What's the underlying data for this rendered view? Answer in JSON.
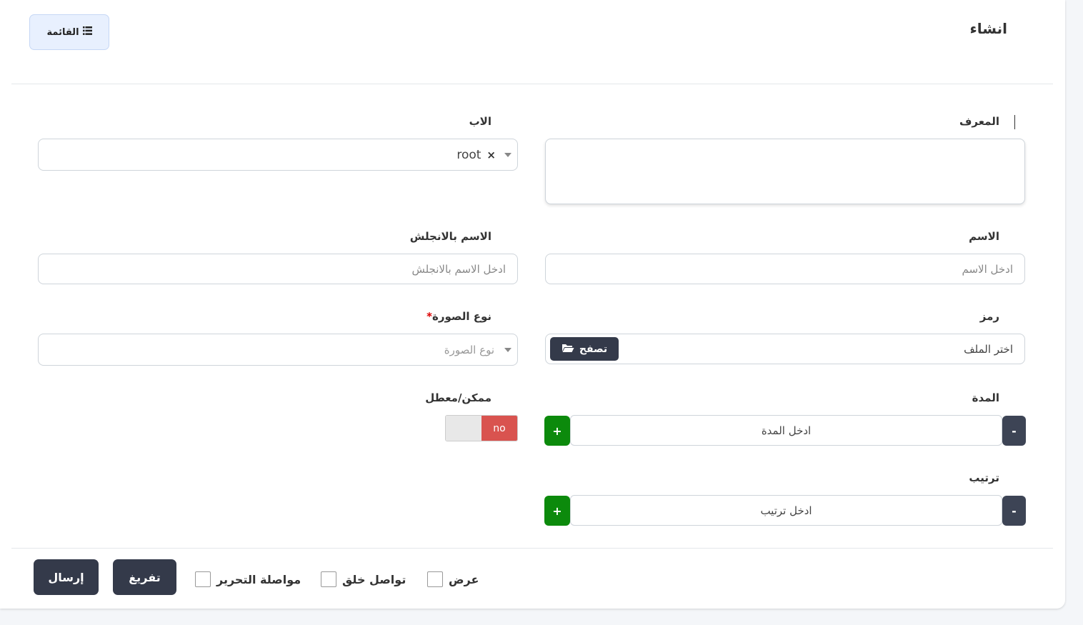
{
  "header": {
    "title": "انشاء",
    "list_button_label": "القائمة",
    "list_icon": "list-icon"
  },
  "form": {
    "identifier": {
      "label": "المعرف",
      "value": ""
    },
    "parent": {
      "label": "الاب",
      "selected": "root",
      "clear_symbol": "×"
    },
    "name": {
      "label": "الاسم",
      "placeholder": "ادخل الاسم"
    },
    "name_en": {
      "label": "الاسم بالانجلش",
      "placeholder": "ادخل الاسم بالانجلش"
    },
    "symbol": {
      "label": "رمز",
      "placeholder": "اختر الملف",
      "browse_label": "تصفح",
      "browse_icon": "folder-open-icon"
    },
    "image_type": {
      "label": "نوع الصورة",
      "required_mark": "*",
      "placeholder": "نوع الصورة"
    },
    "duration": {
      "label": "المدة",
      "placeholder": "ادخل المدة",
      "minus": "-",
      "plus": "+"
    },
    "enabled": {
      "label": "ممكن/معطل",
      "state_label": "no"
    },
    "order": {
      "label": "ترتيب",
      "placeholder": "ادخل ترتيب",
      "minus": "-",
      "plus": "+"
    }
  },
  "footer": {
    "submit_label": "إرسال",
    "clear_label": "تفريغ",
    "continue_edit_label": "مواصلة التحرير",
    "continue_create_label": "تواصل خلق",
    "view_label": "عرض"
  },
  "colors": {
    "dark_button": "#343a4a",
    "plus_green": "#0c8a0c",
    "toggle_no_red": "#d9534f",
    "list_button_bg": "#e8f0fe"
  }
}
